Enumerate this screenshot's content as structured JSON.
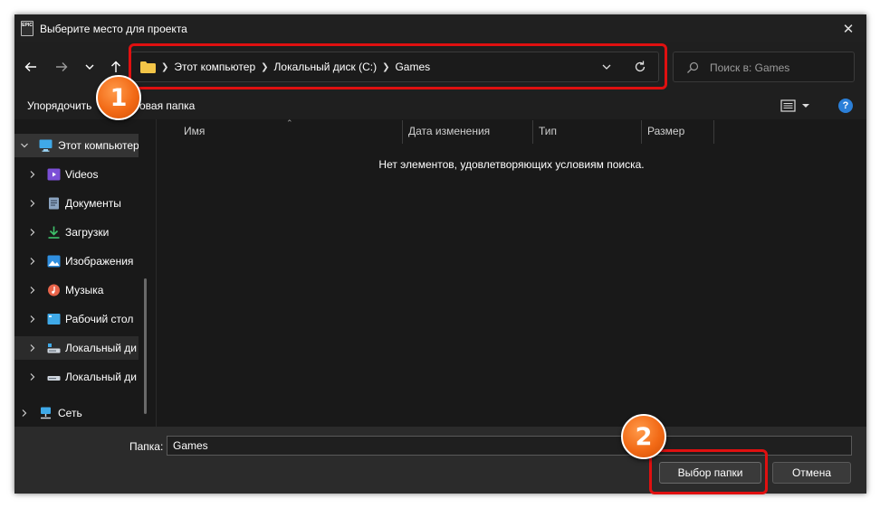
{
  "window": {
    "title": "Выберите место для проекта"
  },
  "navigation": {
    "back": "back-arrow-icon",
    "forward": "forward-arrow-icon",
    "recent": "chevron-down-icon",
    "up": "up-arrow-icon"
  },
  "address": {
    "crumbs": [
      "Этот компьютер",
      "Локальный диск (C:)",
      "Games"
    ]
  },
  "search": {
    "placeholder": "Поиск в: Games"
  },
  "toolbar": {
    "organize": "Упорядочить",
    "new_folder": "овая папка",
    "help": "?"
  },
  "sidebar": {
    "items": [
      {
        "label": "Этот компьютер",
        "icon": "computer-icon"
      },
      {
        "label": "Videos",
        "icon": "videos-icon"
      },
      {
        "label": "Документы",
        "icon": "documents-icon"
      },
      {
        "label": "Загрузки",
        "icon": "downloads-icon"
      },
      {
        "label": "Изображения",
        "icon": "images-icon"
      },
      {
        "label": "Музыка",
        "icon": "music-icon"
      },
      {
        "label": "Рабочий стол",
        "icon": "desktop-icon"
      },
      {
        "label": "Локальный ди",
        "icon": "drive-icon"
      },
      {
        "label": "Локальный ди",
        "icon": "drive-icon"
      },
      {
        "label": "Сеть",
        "icon": "network-icon"
      }
    ]
  },
  "file_list": {
    "columns": [
      "Имя",
      "Дата изменения",
      "Тип",
      "Размер"
    ],
    "empty_message": "Нет элементов, удовлетворяющих условиям поиска."
  },
  "footer": {
    "folder_label": "Папка:",
    "folder_value": "Games",
    "select_button": "Выбор папки",
    "cancel_button": "Отмена"
  },
  "annotations": {
    "badge_1": "1",
    "badge_2": "2"
  },
  "colors": {
    "accent": "#2b7fd8",
    "highlight": "#e01010",
    "badge": "#f26a16",
    "folder": "#f3c548"
  }
}
